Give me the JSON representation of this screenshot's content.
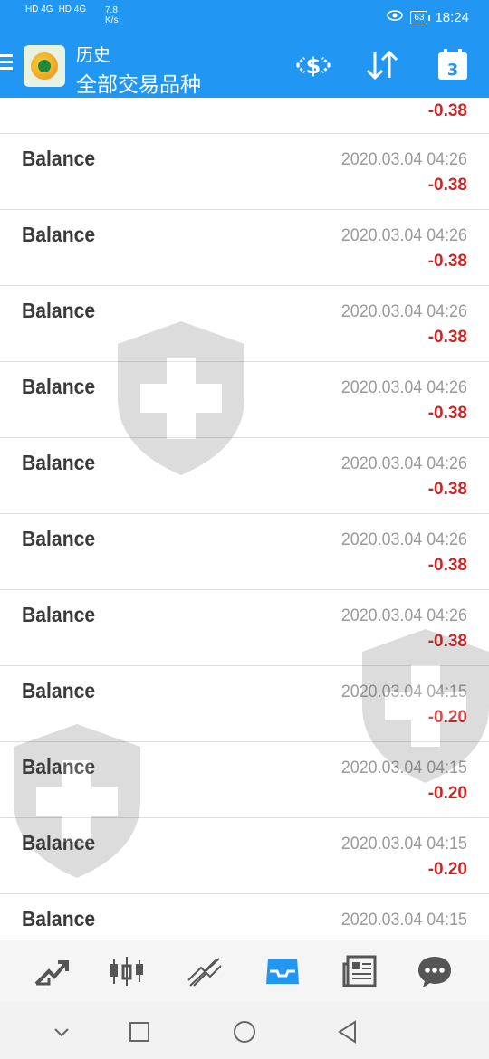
{
  "status_bar": {
    "sim1": "HD 4G",
    "sim2": "HD 4G",
    "net_speed": "7.8\nK/s",
    "battery": "63",
    "time": "18:24"
  },
  "header": {
    "title_small": "历史",
    "title_main": "全部交易品种",
    "icons": [
      "menu-icon",
      "app-logo",
      "deposit-withdraw-icon",
      "sort-icon",
      "calendar-icon"
    ],
    "calendar_day": "3",
    "color": "#2196f3"
  },
  "list": {
    "partial_top_amount": "-0.38",
    "rows": [
      {
        "label": "Balance",
        "time": "2020.03.04 04:26",
        "amount": "-0.38"
      },
      {
        "label": "Balance",
        "time": "2020.03.04 04:26",
        "amount": "-0.38"
      },
      {
        "label": "Balance",
        "time": "2020.03.04 04:26",
        "amount": "-0.38"
      },
      {
        "label": "Balance",
        "time": "2020.03.04 04:26",
        "amount": "-0.38"
      },
      {
        "label": "Balance",
        "time": "2020.03.04 04:26",
        "amount": "-0.38"
      },
      {
        "label": "Balance",
        "time": "2020.03.04 04:26",
        "amount": "-0.38"
      },
      {
        "label": "Balance",
        "time": "2020.03.04 04:26",
        "amount": "-0.38"
      },
      {
        "label": "Balance",
        "time": "2020.03.04 04:15",
        "amount": "-0.20"
      },
      {
        "label": "Balance",
        "time": "2020.03.04 04:15",
        "amount": "-0.20"
      },
      {
        "label": "Balance",
        "time": "2020.03.04 04:15",
        "amount": "-0.20"
      },
      {
        "label": "Balance",
        "time": "2020.03.04 04:15",
        "amount": ""
      }
    ],
    "negative_color": "#c62828"
  },
  "tabbar": {
    "tabs": [
      "quotes-icon",
      "chart-icon",
      "trade-icon",
      "history-icon",
      "news-icon",
      "chat-icon"
    ],
    "active": "history-icon",
    "active_color": "#2196f3"
  },
  "navbar": {
    "buttons": [
      "collapse-icon",
      "recents-icon",
      "home-icon",
      "back-icon"
    ]
  }
}
